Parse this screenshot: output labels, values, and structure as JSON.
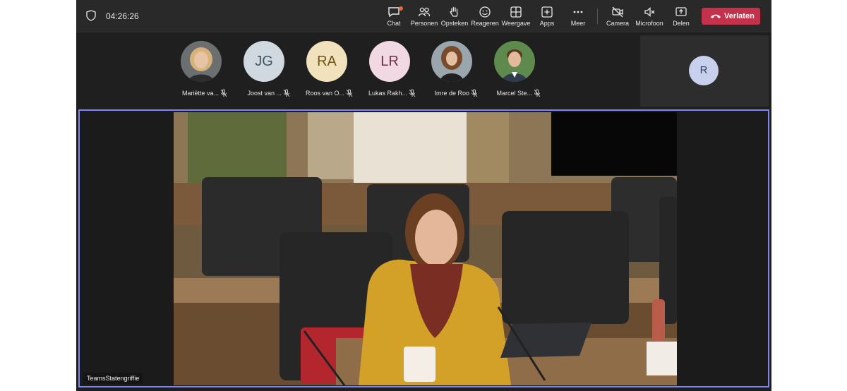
{
  "call": {
    "timer": "04:26:26"
  },
  "toolbar": {
    "chat": "Chat",
    "people": "Personen",
    "raise": "Opsteken",
    "react": "Reageren",
    "view": "Weergave",
    "apps": "Apps",
    "more": "Meer",
    "camera": "Camera",
    "mic": "Microfoon",
    "share": "Delen",
    "leave": "Verlaten"
  },
  "participants": [
    {
      "name": "Mariëtte va...",
      "initials": "",
      "photo": true
    },
    {
      "name": "Joost van ...",
      "initials": "JG",
      "color": "#cfd9df",
      "fg": "#3d5360"
    },
    {
      "name": "Roos van O...",
      "initials": "RA",
      "color": "#f1e2bd",
      "fg": "#6e5415"
    },
    {
      "name": "Lukas Rakh...",
      "initials": "LR",
      "color": "#f0d9e3",
      "fg": "#6b2f49"
    },
    {
      "name": "Imre de Roo",
      "initials": "",
      "photo": true
    },
    {
      "name": "Marcel Ste...",
      "initials": "",
      "photo": true
    }
  ],
  "overflow_participant": {
    "initials": "R"
  },
  "stage": {
    "label": "TeamsStatengriffie"
  },
  "colors": {
    "accent": "#7f85f5",
    "leave": "#c4314b"
  },
  "icons": [
    "shield-icon",
    "chat-icon",
    "people-icon",
    "raise-hand-icon",
    "react-icon",
    "view-icon",
    "apps-icon",
    "more-icon",
    "camera-off-icon",
    "mic-off-icon",
    "share-icon",
    "hangup-icon"
  ]
}
